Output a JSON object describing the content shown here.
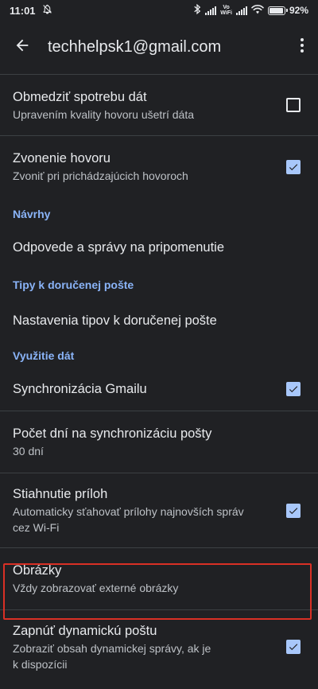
{
  "status_bar": {
    "time": "11:01",
    "volte_top": "Vo",
    "volte_bottom": "WiFi",
    "battery_percent": "92%",
    "battery_level": 0.92,
    "icons": [
      "mute-notifications-icon",
      "bluetooth-icon",
      "signal-icon",
      "volte-wifi-icon",
      "signal-icon",
      "wifi-icon",
      "battery-icon"
    ]
  },
  "app_bar": {
    "title": "techhelpsk1@gmail.com",
    "back_icon": "arrow-left-icon",
    "more_icon": "more-vert-icon"
  },
  "settings": {
    "limit_data": {
      "title": "Obmedziť spotrebu dát",
      "subtitle": "Upravením kvality hovoru ušetrí dáta",
      "checked": false
    },
    "ringtone": {
      "title": "Zvonenie hovoru",
      "subtitle": "Zvoniť pri prichádzajúcich hovoroch",
      "checked": true
    },
    "suggestions_header": "Návrhy",
    "replies_nudges": {
      "title": "Odpovede a správy na pripomenutie"
    },
    "inbox_tips_header": "Tipy k doručenej pošte",
    "inbox_tips": {
      "title": "Nastavenia tipov k doručenej pošte"
    },
    "data_usage_header": "Využitie dát",
    "sync_gmail": {
      "title": "Synchronizácia Gmailu",
      "checked": true
    },
    "days_to_sync": {
      "title": "Počet dní na synchronizáciu pošty",
      "subtitle": "30 dní"
    },
    "download_attachments": {
      "title": "Stiahnutie príloh",
      "subtitle_line1": "Automaticky sťahovať prílohy najnovších správ",
      "subtitle_line2": "cez Wi-Fi",
      "checked": true
    },
    "images": {
      "title": "Obrázky",
      "subtitle": "Vždy zobrazovať externé obrázky"
    },
    "dynamic_email": {
      "title": "Zapnúť dynamickú poštu",
      "subtitle_line1": "Zobraziť obsah dynamickej správy, ak je",
      "subtitle_line2": "k dispozícii",
      "checked": true
    }
  },
  "colors": {
    "background": "#202124",
    "accent": "#8ab4f8",
    "checkbox_checked": "#a8c7fa",
    "highlight_border": "#d93025"
  }
}
